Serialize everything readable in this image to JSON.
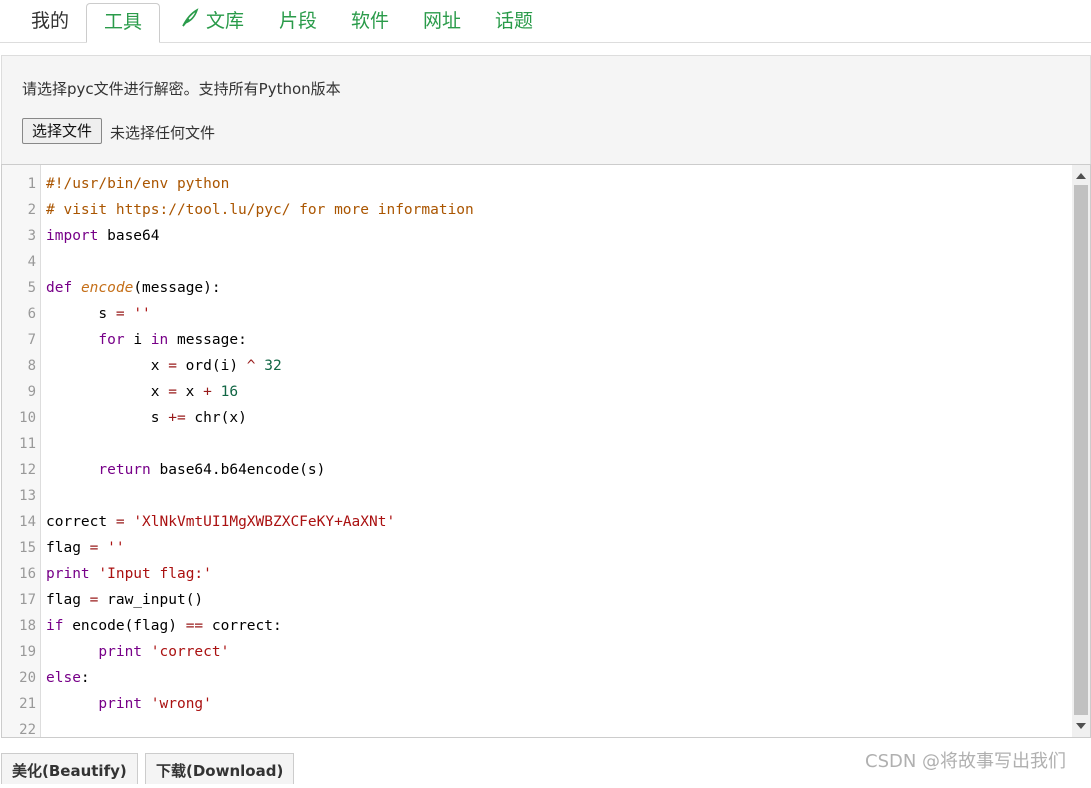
{
  "tabs": [
    {
      "label": "我的"
    },
    {
      "label": "工具"
    },
    {
      "label": "文库"
    },
    {
      "label": "片段"
    },
    {
      "label": "软件"
    },
    {
      "label": "网址"
    },
    {
      "label": "话题"
    }
  ],
  "upload": {
    "description": "请选择pyc文件进行解密。支持所有Python版本",
    "choose_button": "选择文件",
    "no_file_text": "未选择任何文件"
  },
  "editor": {
    "line_numbers": [
      "1",
      "2",
      "3",
      "4",
      "5",
      "6",
      "7",
      "8",
      "9",
      "10",
      "11",
      "12",
      "13",
      "14",
      "15",
      "16",
      "17",
      "18",
      "19",
      "20",
      "21",
      "22"
    ],
    "lines": [
      "#!/usr/bin/env python",
      "# visit https://tool.lu/pyc/ for more information",
      "import base64",
      "",
      "def encode(message):",
      "      s = ''",
      "      for i in message:",
      "            x = ord(i) ^ 32",
      "            x = x + 16",
      "            s += chr(x)",
      "",
      "      return base64.b64encode(s)",
      "",
      "correct = 'XlNkVmtUI1MgXWBZXCFeKY+AaXNt'",
      "flag = ''",
      "print 'Input flag:'",
      "flag = raw_input()",
      "if encode(flag) == correct:",
      "      print 'correct'",
      "else:",
      "      print 'wrong'",
      ""
    ]
  },
  "buttons": {
    "beautify": "美化(Beautify)",
    "download": "下载(Download)"
  },
  "watermark": "CSDN @将故事写出我们",
  "colors": {
    "tab_green": "#2a9b4a",
    "keyword": "#770088",
    "string": "#aa1111",
    "function": "#c5701a"
  },
  "icons": {
    "tab_wenku": "feather-icon"
  }
}
